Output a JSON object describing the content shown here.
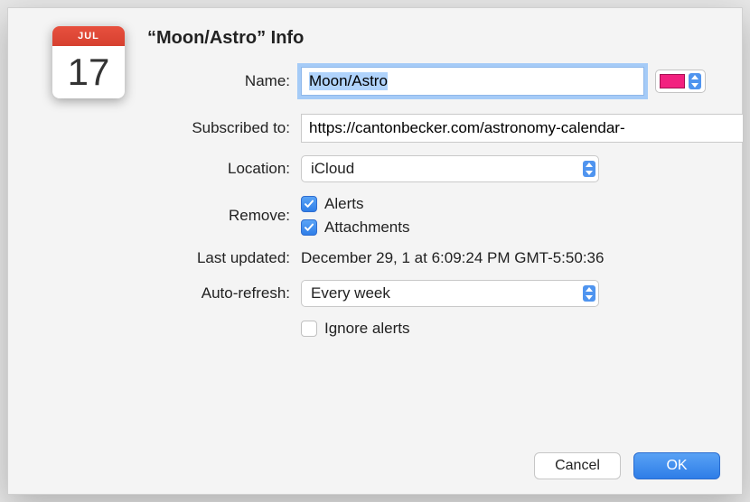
{
  "icon": {
    "month": "JUL",
    "day": "17"
  },
  "title": "“Moon/Astro” Info",
  "labels": {
    "name": "Name:",
    "subscribed": "Subscribed to:",
    "location": "Location:",
    "remove": "Remove:",
    "last_updated": "Last updated:",
    "auto_refresh": "Auto-refresh:"
  },
  "fields": {
    "name": "Moon/Astro",
    "subscribed_url": "https://cantonbecker.com/astronomy-calendar-",
    "location": "iCloud",
    "remove_alerts": {
      "label": "Alerts",
      "checked": true
    },
    "remove_attachments": {
      "label": "Attachments",
      "checked": true
    },
    "last_updated_value": "December 29, 1 at 6:09:24 PM GMT-5:50:36",
    "auto_refresh": "Every week",
    "ignore_alerts": {
      "label": "Ignore alerts",
      "checked": false
    }
  },
  "color": "#f2207f",
  "buttons": {
    "cancel": "Cancel",
    "ok": "OK"
  }
}
